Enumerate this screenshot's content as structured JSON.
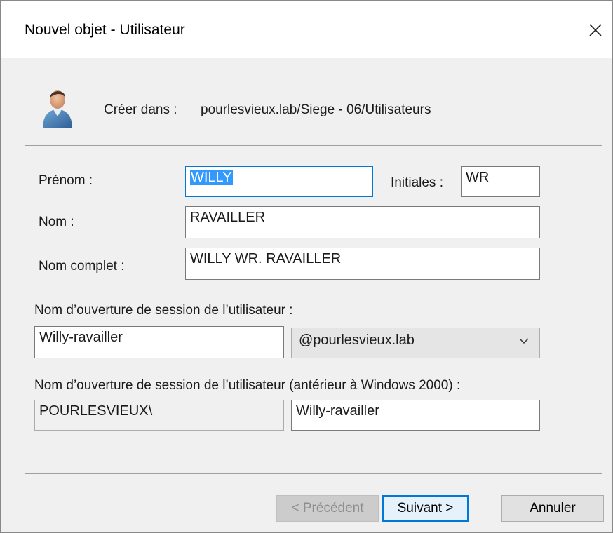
{
  "window": {
    "title": "Nouvel objet - Utilisateur"
  },
  "header": {
    "create_in_label": "Créer dans :",
    "create_in_path": "pourlesvieux.lab/Siege - 06/Utilisateurs"
  },
  "form": {
    "first_name": {
      "label": "Prénom :",
      "value": "WILLY"
    },
    "initials": {
      "label": "Initiales :",
      "value": "WR"
    },
    "last_name": {
      "label": "Nom :",
      "value": "RAVAILLER"
    },
    "full_name": {
      "label": "Nom complet :",
      "value": "WILLY WR. RAVAILLER"
    },
    "logon_name": {
      "label": "Nom d’ouverture de session de l’utilisateur :",
      "value": "Willy-ravailler",
      "domain": "@pourlesvieux.lab"
    },
    "logon_name_pre2000": {
      "label": "Nom d’ouverture de session de l’utilisateur (antérieur à Windows 2000) :",
      "domain_prefix": "POURLESVIEUX\\",
      "value": "Willy-ravailler"
    }
  },
  "buttons": {
    "previous": "< Précédent",
    "next": "Suivant >",
    "cancel": "Annuler"
  },
  "icons": {
    "close": "close-icon",
    "user": "user-icon",
    "dropdown": "chevron-down-icon"
  },
  "colors": {
    "accent": "#0078d7",
    "selection": "#3399ff",
    "window_bg": "#f0f0f0"
  }
}
